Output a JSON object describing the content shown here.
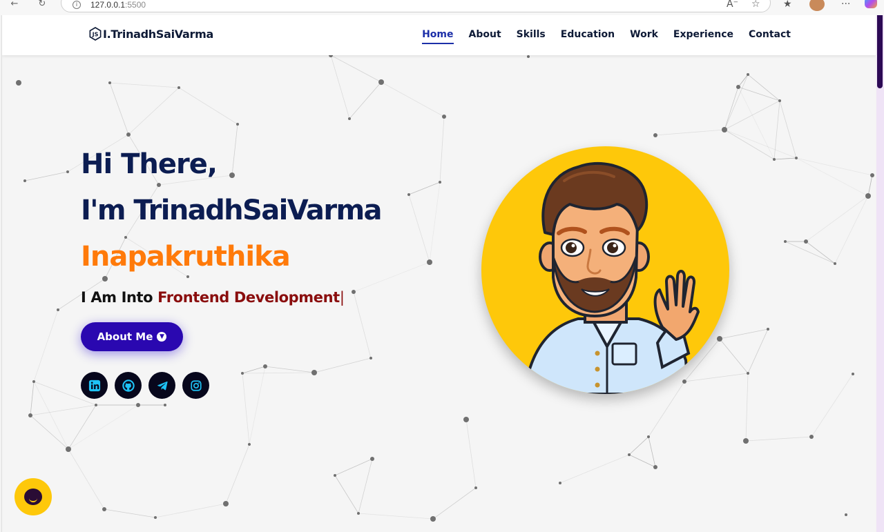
{
  "browser": {
    "url_host": "127.0.0.1",
    "url_port": ":5500",
    "info_icon": "info-icon",
    "back_icon": "back-arrow-icon",
    "reload_icon": "reload-icon",
    "read_aloud_icon": "read-aloud-icon",
    "favorite_icon": "star-icon",
    "collections_icon": "collections-icon",
    "more_icon": "more-icon"
  },
  "header": {
    "logo_text": "I.TrinadhSaiVarma",
    "logo_icon": "nodejs-hexagon-icon",
    "nav": [
      {
        "label": "Home",
        "active": true
      },
      {
        "label": "About",
        "active": false
      },
      {
        "label": "Skills",
        "active": false
      },
      {
        "label": "Education",
        "active": false
      },
      {
        "label": "Work",
        "active": false
      },
      {
        "label": "Experience",
        "active": false
      },
      {
        "label": "Contact",
        "active": false
      }
    ],
    "active_color": "#1c2fa8"
  },
  "hero": {
    "greeting": "Hi There,",
    "name": "I'm TrinadhSaiVarma",
    "surname": "Inapakruthika",
    "tagline_prefix": "I Am Into ",
    "tagline_typed": "Frontend Development",
    "tagline_cursor": "|",
    "button_label": "About Me",
    "button_icon": "arrow-down-circle-icon",
    "accent_color": "#ff7a0a",
    "button_color": "#2a08b0"
  },
  "socials": [
    {
      "name": "linkedin",
      "icon": "linkedin-icon"
    },
    {
      "name": "github",
      "icon": "github-icon"
    },
    {
      "name": "telegram",
      "icon": "telegram-icon"
    },
    {
      "name": "instagram",
      "icon": "instagram-icon"
    }
  ],
  "avatar": {
    "icon": "cartoon-avatar-waving",
    "background_color": "#fec80a"
  },
  "chat_widget": {
    "icon": "chat-bubble-icon",
    "color": "#fec80a"
  }
}
